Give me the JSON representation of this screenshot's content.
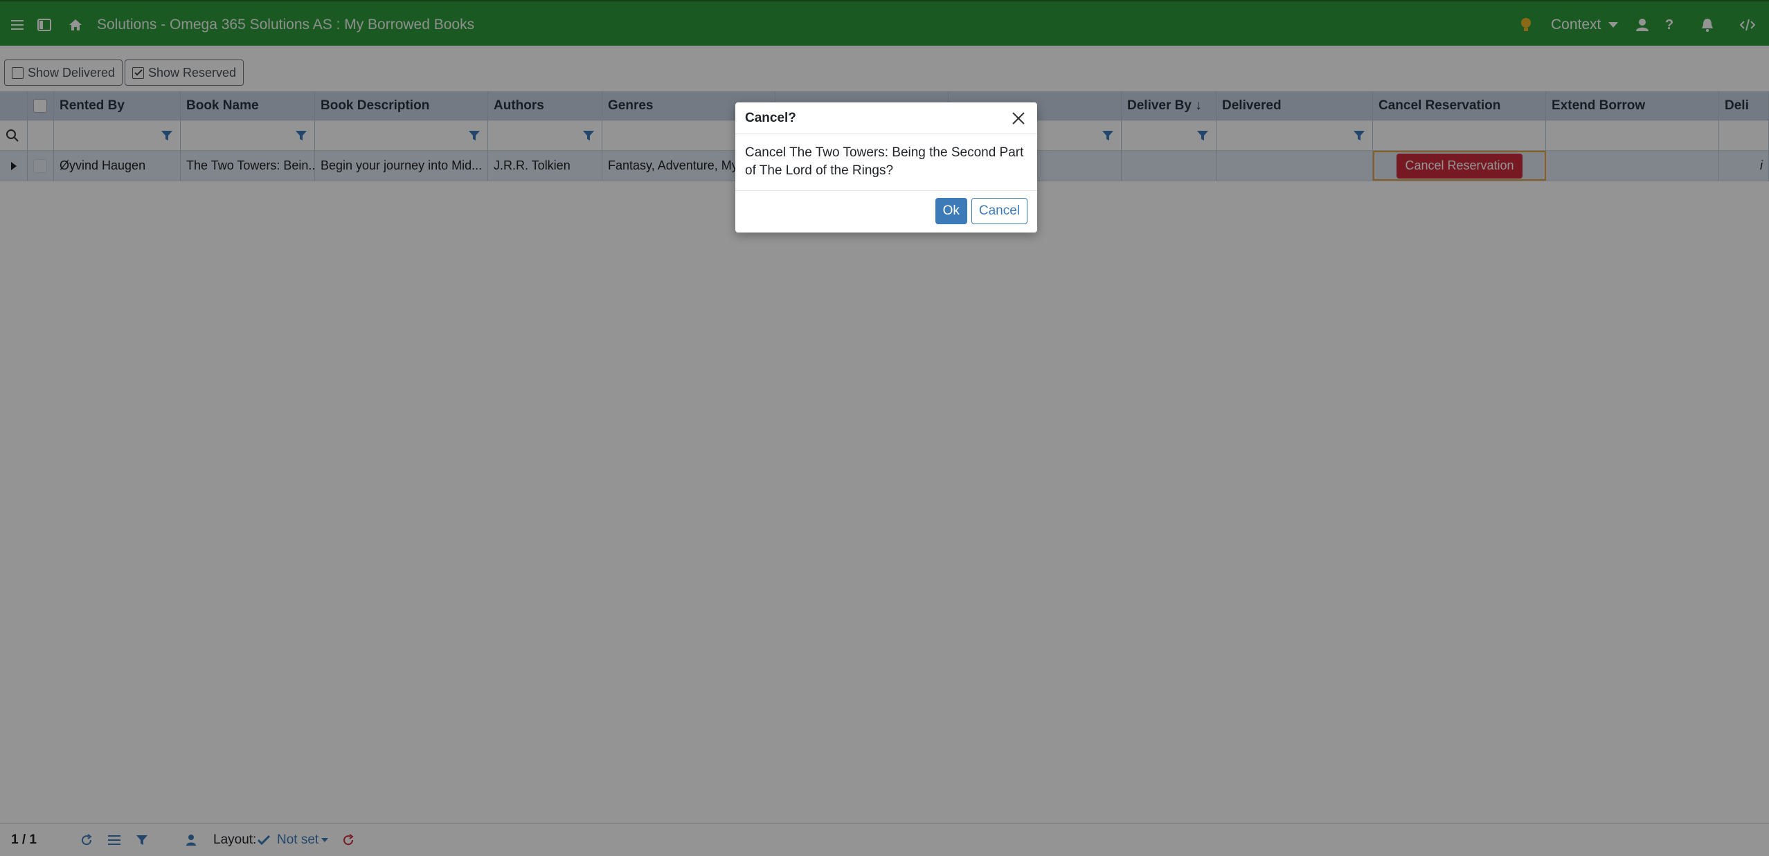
{
  "topbar": {
    "title": "Solutions - Omega 365 Solutions AS : My Borrowed Books",
    "context_label": "Context"
  },
  "toolbar": {
    "show_delivered": "Show Delivered",
    "show_reserved": "Show Reserved"
  },
  "grid": {
    "columns": [
      "Rented By",
      "Book Name",
      "Book Description",
      "Authors",
      "Genres",
      "Deliver By ↓",
      "Delivered",
      "Cancel Reservation",
      "Extend Borrow",
      "Deli"
    ],
    "row": {
      "rented_by": "Øyvind Haugen",
      "book_name": "The Two Towers: Bein...",
      "book_description": "Begin your journey into Mid...",
      "authors": "J.R.R. Tolkien",
      "genres": "Fantasy, Adventure, My",
      "cancel_reservation_button": "Cancel Reservation",
      "info": "i"
    }
  },
  "modal": {
    "title": "Cancel?",
    "message": "Cancel The Two Towers: Being the Second Part of The Lord of the Rings?",
    "ok_label": "Ok",
    "cancel_label": "Cancel"
  },
  "footer": {
    "record_count": "1 / 1",
    "layout_label": "Layout:",
    "layout_value": "Not set"
  },
  "colors": {
    "topbar": "#2f9a3d",
    "danger": "#cc2b3c",
    "primary": "#3d7ab8"
  }
}
